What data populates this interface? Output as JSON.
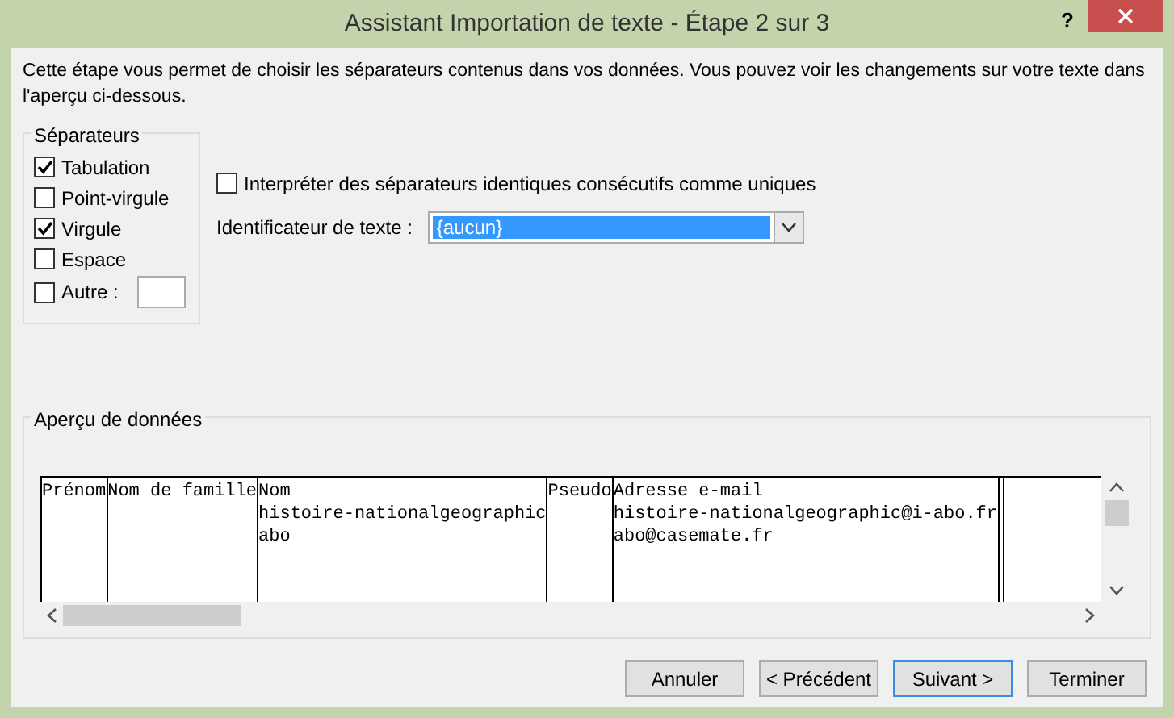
{
  "window": {
    "title": "Assistant Importation de texte - Étape 2 sur 3",
    "help": "?"
  },
  "description": "Cette étape vous permet de choisir les séparateurs contenus dans vos données. Vous pouvez voir les changements sur votre texte dans l'aperçu ci-dessous.",
  "separators": {
    "legend": "Séparateurs",
    "items": [
      {
        "label": "Tabulation",
        "checked": true,
        "kind": "checkbox"
      },
      {
        "label": "Point-virgule",
        "checked": false,
        "kind": "checkbox"
      },
      {
        "label": "Virgule",
        "checked": true,
        "kind": "checkbox"
      },
      {
        "label": "Espace",
        "checked": false,
        "kind": "checkbox"
      },
      {
        "label": "Autre :",
        "checked": false,
        "kind": "checkbox-with-field"
      }
    ]
  },
  "consecutive": {
    "label": "Interpréter des séparateurs identiques consécutifs comme uniques",
    "checked": false
  },
  "text_qualifier": {
    "label": "Identificateur de texte :",
    "value": "{aucun}"
  },
  "preview": {
    "legend": "Aperçu de données",
    "columns": [
      {
        "lines": [
          "Prénom"
        ]
      },
      {
        "lines": [
          "Nom de famille"
        ]
      },
      {
        "lines": [
          "Nom",
          "histoire-nationalgeographic",
          "abo"
        ]
      },
      {
        "lines": [
          "Pseudo"
        ]
      },
      {
        "lines": [
          "Adresse e-mail",
          "histoire-nationalgeographic@i-abo.fr",
          "abo@casemate.fr"
        ]
      }
    ]
  },
  "buttons": [
    {
      "label": "Annuler",
      "default": false
    },
    {
      "label": "< Précédent",
      "default": false
    },
    {
      "label": "Suivant >",
      "default": true
    },
    {
      "label": "Terminer",
      "default": false
    }
  ]
}
